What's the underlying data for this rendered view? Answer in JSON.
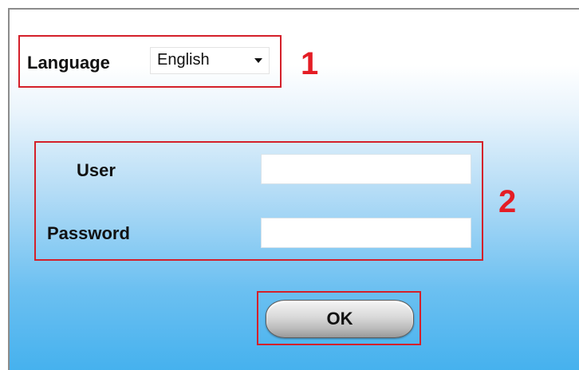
{
  "language": {
    "label": "Language",
    "selected": "English"
  },
  "login": {
    "user_label": "User",
    "user_value": "",
    "password_label": "Password",
    "password_value": ""
  },
  "ok_label": "OK",
  "callouts": [
    "1",
    "2"
  ],
  "colors": {
    "callout": "#d4202a",
    "background_top": "#ffffff",
    "background_bottom": "#45b1ee"
  }
}
